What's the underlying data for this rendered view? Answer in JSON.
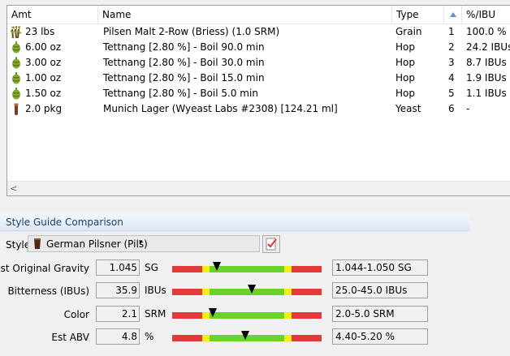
{
  "grid": {
    "columns": {
      "amt": "Amt",
      "name": "Name",
      "type": "Type",
      "ibu": "%/IBU"
    },
    "rows": [
      {
        "icon": "grain-icon",
        "amt": "23 lbs",
        "name": "Pilsen Malt 2-Row (Briess) (1.0 SRM)",
        "type": "Grain",
        "idx": "1",
        "ibu": "100.0 %"
      },
      {
        "icon": "hop-icon",
        "amt": "6.00 oz",
        "name": "Tettnang [2.80 %] - Boil 90.0 min",
        "type": "Hop",
        "idx": "2",
        "ibu": "24.2 IBUs"
      },
      {
        "icon": "hop-icon",
        "amt": "3.00 oz",
        "name": "Tettnang [2.80 %] - Boil 30.0 min",
        "type": "Hop",
        "idx": "3",
        "ibu": "8.7 IBUs"
      },
      {
        "icon": "hop-icon",
        "amt": "1.00 oz",
        "name": "Tettnang [2.80 %] - Boil 15.0 min",
        "type": "Hop",
        "idx": "4",
        "ibu": "1.9 IBUs"
      },
      {
        "icon": "hop-icon",
        "amt": "1.50 oz",
        "name": "Tettnang [2.80 %] - Boil 5.0 min",
        "type": "Hop",
        "idx": "5",
        "ibu": "1.1 IBUs"
      },
      {
        "icon": "yeast-icon",
        "amt": "2.0 pkg",
        "name": "Munich Lager (Wyeast Labs #2308) [124.21 ml]",
        "type": "Yeast",
        "idx": "6",
        "ibu": "-"
      }
    ],
    "scroll_left": "<"
  },
  "style_guide": {
    "title": "Style Guide Comparison",
    "style_label": "Style",
    "style_value": "German Pilsner (Pils)",
    "style_caret": "▾",
    "rows": [
      {
        "label": "Est Original Gravity",
        "value": "1.045",
        "unit": "SG",
        "range": "1.044-1.050 SG",
        "marker": 0.3
      },
      {
        "label": "Bitterness (IBUs)",
        "value": "35.9",
        "unit": "IBUs",
        "range": "25.0-45.0 IBUs",
        "marker": 0.53
      },
      {
        "label": "Color",
        "value": "2.1",
        "unit": "SRM",
        "range": "2.0-5.0 SRM",
        "marker": 0.27
      },
      {
        "label": "Est ABV",
        "value": "4.8",
        "unit": "%",
        "range": "4.40-5.20 %",
        "marker": 0.49
      }
    ]
  },
  "colors": {
    "meter_red": "#e23a3a",
    "meter_yellow": "#f5ef11",
    "meter_green": "#6cd12b",
    "marker": "#000000"
  }
}
